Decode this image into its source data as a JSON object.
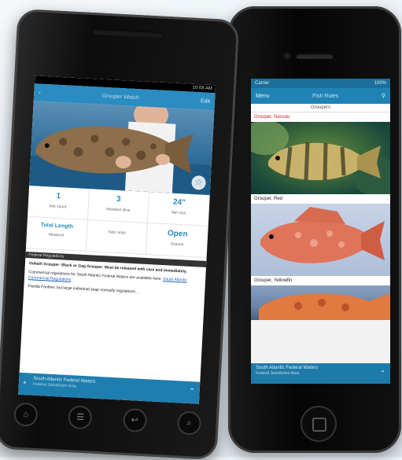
{
  "android": {
    "status_time": "10:08 AM",
    "nav_back": "‹",
    "nav_title": "Grouper Watch",
    "nav_action": "Edit",
    "stats": [
      {
        "value": "1",
        "label": "fish count"
      },
      {
        "value": "3",
        "label": "released alive"
      },
      {
        "value": "24\"",
        "label": "fish size"
      },
      {
        "value": "Total Length",
        "label": "Measure"
      },
      {
        "value": "",
        "label": "Size Units"
      },
      {
        "value": "Open",
        "label": "Season"
      }
    ],
    "notes_header": "Federal Regulations",
    "notes": [
      "Goliath Grouper: Black or Gag Grouper. Must be released with care and immediately.",
      "Commercial regulations for South Atlantic Federal Waters are available here:",
      "Florida Panther, but large individual snap normally regulations..."
    ],
    "link_text": "South Atlantic Commercial Regulations",
    "bottom_title": "South Atlantic Federal Waters",
    "bottom_sub": "Federal Jurisdiction Area",
    "keys": [
      "⌂",
      "☰",
      "↩",
      "⌕"
    ]
  },
  "ios": {
    "status_left": "Carrier",
    "status_right": "100%",
    "nav_left": "Menu",
    "nav_title": "Fish Rules",
    "nav_right": "⚲",
    "subheader": "Groupers",
    "items": [
      {
        "label": "Grouper, Nassau",
        "highlight": true
      },
      {
        "label": "Grouper, Red",
        "highlight": false
      },
      {
        "label": "Grouper, Yellowfin",
        "highlight": false
      }
    ],
    "bottom_title": "South Atlantic Federal Waters",
    "bottom_sub": "Federal Jurisdiction Area"
  },
  "colors": {
    "brand_blue": "#2a8cc0",
    "highlight_red": "#dd2222"
  },
  "icons": [
    "back-icon",
    "star-icon",
    "location-pin-icon",
    "chevron-up-icon",
    "search-icon",
    "home-icon",
    "menu-icon",
    "back-arrow-icon"
  ]
}
